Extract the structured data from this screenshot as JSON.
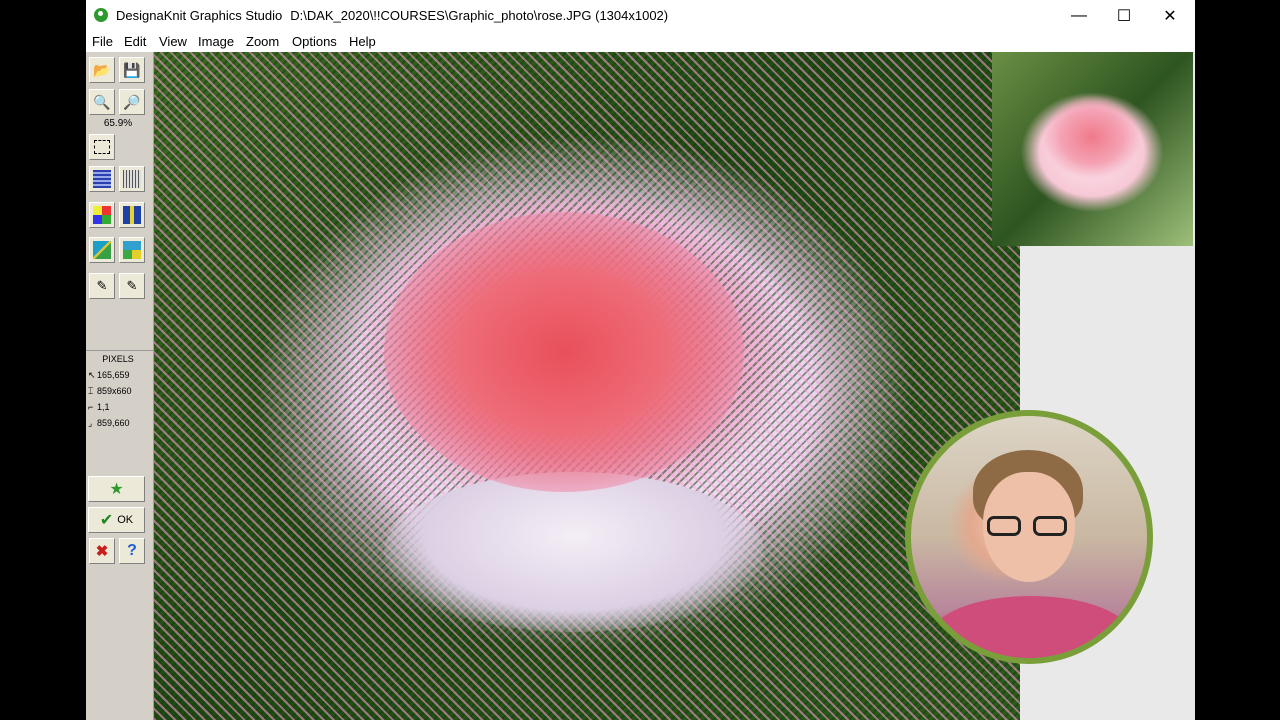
{
  "window": {
    "app_name": "DesignaKnit Graphics Studio",
    "file_path": "D:\\DAK_2020\\!!COURSES\\Graphic_photo\\rose.JPG (1304x1002)",
    "controls": {
      "minimize": "—",
      "maximize": "☐",
      "close": "✕"
    }
  },
  "menu": [
    "File",
    "Edit",
    "View",
    "Image",
    "Zoom",
    "Options",
    "Help"
  ],
  "toolbar": {
    "zoom_level": "65.9%",
    "pixels_label": "PIXELS",
    "coords": {
      "cursor": "165,659",
      "size": "859x660",
      "start": "1,1",
      "end": "859,660"
    },
    "ok_label": "OK",
    "help_symbol": "?",
    "cancel_symbol": "✖"
  },
  "colors": {
    "accent_green": "#2e9a2e",
    "rose_red": "#e9505a",
    "rose_pink": "#f6a9c8",
    "leaf_green": "#1e4812",
    "webcam_ring": "#7a9f3a"
  },
  "icons": {
    "open": "open-folder-icon",
    "save": "save-disk-icon",
    "zoom_in": "zoom-in-icon",
    "zoom_out": "zoom-out-icon",
    "select": "selection-icon",
    "grid_a": "grid-pattern-icon",
    "grid_b": "grid-empty-icon",
    "palette": "color-palette-icon",
    "merge": "color-merge-icon",
    "pencil": "draw-pencil-icon",
    "pixelize": "pixelize-icon",
    "dropper": "eyedropper-icon",
    "dropper2": "eyedropper-alt-icon",
    "star": "star-icon"
  }
}
